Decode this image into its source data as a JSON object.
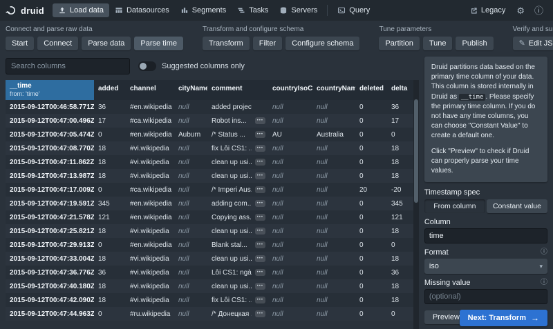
{
  "app": {
    "brand": "druid",
    "nav": [
      {
        "label": "Load data"
      },
      {
        "label": "Datasources"
      },
      {
        "label": "Segments"
      },
      {
        "label": "Tasks"
      },
      {
        "label": "Servers"
      },
      {
        "label": "Query"
      }
    ],
    "legacy_label": "Legacy"
  },
  "icons": {
    "gear": "⚙",
    "info": "ⓘ",
    "edit": "✎",
    "caret": "▾",
    "arrow_right": "→",
    "more": "•••"
  },
  "steps": {
    "groups": [
      {
        "title": "Connect and parse raw data",
        "steps": [
          {
            "label": "Start"
          },
          {
            "label": "Connect"
          },
          {
            "label": "Parse data"
          },
          {
            "label": "Parse time"
          }
        ]
      },
      {
        "title": "Transform and configure schema",
        "steps": [
          {
            "label": "Transform"
          },
          {
            "label": "Filter"
          },
          {
            "label": "Configure schema"
          }
        ]
      },
      {
        "title": "Tune parameters",
        "steps": [
          {
            "label": "Partition"
          },
          {
            "label": "Tune"
          },
          {
            "label": "Publish"
          }
        ]
      },
      {
        "title": "Verify and submit",
        "steps": [
          {
            "label": "Edit JSON spec"
          }
        ]
      }
    ]
  },
  "filters": {
    "search_placeholder": "Search columns",
    "toggle_label": "Suggested columns only"
  },
  "table": {
    "time_column": {
      "name": "__time",
      "from": "from: 'time'"
    },
    "columns": [
      "added",
      "channel",
      "cityName",
      "comment",
      "countryIsoCode",
      "countryName",
      "deleted",
      "delta"
    ],
    "rows": [
      {
        "time": "2015-09-12T00:46:58.771Z",
        "added": "36",
        "channel": "#en.wikipedia",
        "cityName": "null",
        "comment": "added project",
        "more": false,
        "countryIsoCode": "null",
        "countryName": "null",
        "deleted": "0",
        "delta": "36"
      },
      {
        "time": "2015-09-12T00:47:00.496Z",
        "added": "17",
        "channel": "#ca.wikipedia",
        "cityName": "null",
        "comment": "Robot ins...",
        "more": true,
        "countryIsoCode": "null",
        "countryName": "null",
        "deleted": "0",
        "delta": "17"
      },
      {
        "time": "2015-09-12T00:47:05.474Z",
        "added": "0",
        "channel": "#en.wikipedia",
        "cityName": "Auburn",
        "comment": "/* Status ...",
        "more": true,
        "countryIsoCode": "AU",
        "countryName": "Australia",
        "deleted": "0",
        "delta": "0"
      },
      {
        "time": "2015-09-12T00:47:08.770Z",
        "added": "18",
        "channel": "#vi.wikipedia",
        "cityName": "null",
        "comment": "fix Lỗi CS1: ...",
        "more": true,
        "countryIsoCode": "null",
        "countryName": "null",
        "deleted": "0",
        "delta": "18"
      },
      {
        "time": "2015-09-12T00:47:11.862Z",
        "added": "18",
        "channel": "#vi.wikipedia",
        "cityName": "null",
        "comment": "clean up usi...",
        "more": true,
        "countryIsoCode": "null",
        "countryName": "null",
        "deleted": "0",
        "delta": "18"
      },
      {
        "time": "2015-09-12T00:47:13.987Z",
        "added": "18",
        "channel": "#vi.wikipedia",
        "cityName": "null",
        "comment": "clean up usi...",
        "more": true,
        "countryIsoCode": "null",
        "countryName": "null",
        "deleted": "0",
        "delta": "18"
      },
      {
        "time": "2015-09-12T00:47:17.009Z",
        "added": "0",
        "channel": "#ca.wikipedia",
        "cityName": "null",
        "comment": "/* Imperi Aus...",
        "more": true,
        "countryIsoCode": "null",
        "countryName": "null",
        "deleted": "20",
        "delta": "-20"
      },
      {
        "time": "2015-09-12T00:47:19.591Z",
        "added": "345",
        "channel": "#en.wikipedia",
        "cityName": "null",
        "comment": "adding com...",
        "more": true,
        "countryIsoCode": "null",
        "countryName": "null",
        "deleted": "0",
        "delta": "345"
      },
      {
        "time": "2015-09-12T00:47:21.578Z",
        "added": "121",
        "channel": "#en.wikipedia",
        "cityName": "null",
        "comment": "Copying ass...",
        "more": true,
        "countryIsoCode": "null",
        "countryName": "null",
        "deleted": "0",
        "delta": "121"
      },
      {
        "time": "2015-09-12T00:47:25.821Z",
        "added": "18",
        "channel": "#vi.wikipedia",
        "cityName": "null",
        "comment": "clean up usi...",
        "more": true,
        "countryIsoCode": "null",
        "countryName": "null",
        "deleted": "0",
        "delta": "18"
      },
      {
        "time": "2015-09-12T00:47:29.913Z",
        "added": "0",
        "channel": "#en.wikipedia",
        "cityName": "null",
        "comment": "Blank stal...",
        "more": true,
        "countryIsoCode": "null",
        "countryName": "null",
        "deleted": "0",
        "delta": "0"
      },
      {
        "time": "2015-09-12T00:47:33.004Z",
        "added": "18",
        "channel": "#vi.wikipedia",
        "cityName": "null",
        "comment": "clean up usi...",
        "more": true,
        "countryIsoCode": "null",
        "countryName": "null",
        "deleted": "0",
        "delta": "18"
      },
      {
        "time": "2015-09-12T00:47:36.776Z",
        "added": "36",
        "channel": "#vi.wikipedia",
        "cityName": "null",
        "comment": "Lỗi CS1: ngà...",
        "more": true,
        "countryIsoCode": "null",
        "countryName": "null",
        "deleted": "0",
        "delta": "36"
      },
      {
        "time": "2015-09-12T00:47:40.180Z",
        "added": "18",
        "channel": "#vi.wikipedia",
        "cityName": "null",
        "comment": "clean up usi...",
        "more": true,
        "countryIsoCode": "null",
        "countryName": "null",
        "deleted": "0",
        "delta": "18"
      },
      {
        "time": "2015-09-12T00:47:42.090Z",
        "added": "18",
        "channel": "#vi.wikipedia",
        "cityName": "null",
        "comment": "fix Lỗi CS1: ...",
        "more": true,
        "countryIsoCode": "null",
        "countryName": "null",
        "deleted": "0",
        "delta": "18"
      },
      {
        "time": "2015-09-12T00:47:44.963Z",
        "added": "0",
        "channel": "#ru.wikipedia",
        "cityName": "null",
        "comment": "/* Донецкая ...",
        "more": true,
        "countryIsoCode": "null",
        "countryName": "null",
        "deleted": "0",
        "delta": "0"
      }
    ]
  },
  "sidebar": {
    "info_p1_a": "Druid partitions data based on the primary time column of your data. This column is stored internally in Druid as ",
    "info_p1_code": "__time",
    "info_p1_b": ". Please specify the primary time column. If you do not have any time columns, you can choose \"Constant Value\" to create a default one.",
    "info_p2": "Click \"Preview\" to check if Druid can properly parse your time values.",
    "timestamp_spec_label": "Timestamp spec",
    "from_column_label": "From column",
    "constant_value_label": "Constant value",
    "column_label": "Column",
    "column_value": "time",
    "format_label": "Format",
    "format_value": "iso",
    "missing_value_label": "Missing value",
    "missing_value_placeholder": "(optional)",
    "preview_label": "Preview"
  },
  "footer": {
    "next_label": "Next: Transform"
  }
}
